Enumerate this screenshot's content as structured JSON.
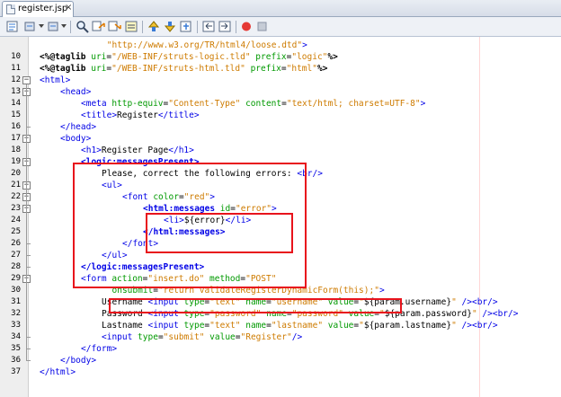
{
  "tab": {
    "label": "register.jsp",
    "close": "×"
  },
  "toolbar": {
    "icons": [
      "last-edit-icon",
      "back-icon",
      "forward-icon",
      "find-icon",
      "find-previous-icon",
      "find-next-icon",
      "toggle-highlight-icon",
      "previous-bookmark-icon",
      "next-bookmark-icon",
      "toggle-bookmark-icon",
      "shift-left-icon",
      "shift-right-icon",
      "start-macro-icon",
      "stop-macro-icon"
    ]
  },
  "editor": {
    "lines": [
      {
        "num": "",
        "segs": [
          {
            "c": "str",
            "t": "\"http://www.w3.org/TR/html4/loose.dtd\""
          },
          {
            "c": "tag",
            "t": ">"
          }
        ],
        "indent": 13
      },
      {
        "num": "10",
        "segs": [
          {
            "c": "jsp",
            "t": "<%@"
          },
          {
            "c": "jsp",
            "t": "taglib "
          },
          {
            "c": "attr",
            "t": "uri"
          },
          {
            "c": "txt",
            "t": "="
          },
          {
            "c": "str",
            "t": "\"/WEB-INF/struts-logic.tld\""
          },
          {
            "c": "txt",
            "t": " "
          },
          {
            "c": "attr",
            "t": "prefix"
          },
          {
            "c": "txt",
            "t": "="
          },
          {
            "c": "str",
            "t": "\"logic\""
          },
          {
            "c": "jsp",
            "t": "%>"
          }
        ],
        "indent": 0
      },
      {
        "num": "11",
        "segs": [
          {
            "c": "jsp",
            "t": "<%@"
          },
          {
            "c": "jsp",
            "t": "taglib "
          },
          {
            "c": "attr",
            "t": "uri"
          },
          {
            "c": "txt",
            "t": "="
          },
          {
            "c": "str",
            "t": "\"/WEB-INF/struts-html.tld\""
          },
          {
            "c": "txt",
            "t": " "
          },
          {
            "c": "attr",
            "t": "prefix"
          },
          {
            "c": "txt",
            "t": "="
          },
          {
            "c": "str",
            "t": "\"html\""
          },
          {
            "c": "jsp",
            "t": "%>"
          }
        ],
        "indent": 0
      },
      {
        "num": "12",
        "segs": [
          {
            "c": "tag",
            "t": "<html>"
          }
        ],
        "indent": 0
      },
      {
        "num": "13",
        "segs": [
          {
            "c": "tag",
            "t": "<head>"
          }
        ],
        "indent": 4
      },
      {
        "num": "14",
        "segs": [
          {
            "c": "tag",
            "t": "<meta "
          },
          {
            "c": "attr",
            "t": "http-equiv"
          },
          {
            "c": "txt",
            "t": "="
          },
          {
            "c": "str",
            "t": "\"Content-Type\""
          },
          {
            "c": "txt",
            "t": " "
          },
          {
            "c": "attr",
            "t": "content"
          },
          {
            "c": "txt",
            "t": "="
          },
          {
            "c": "str",
            "t": "\"text/html; charset=UTF-8\""
          },
          {
            "c": "tag",
            "t": ">"
          }
        ],
        "indent": 8
      },
      {
        "num": "15",
        "segs": [
          {
            "c": "tag",
            "t": "<title>"
          },
          {
            "c": "txt",
            "t": "Register"
          },
          {
            "c": "tag",
            "t": "</title>"
          }
        ],
        "indent": 8
      },
      {
        "num": "16",
        "segs": [
          {
            "c": "tag",
            "t": "</head>"
          }
        ],
        "indent": 4
      },
      {
        "num": "17",
        "segs": [
          {
            "c": "tag",
            "t": "<body>"
          }
        ],
        "indent": 4
      },
      {
        "num": "18",
        "segs": [
          {
            "c": "tag",
            "t": "<h1>"
          },
          {
            "c": "txt",
            "t": "Register Page"
          },
          {
            "c": "tag",
            "t": "</h1>"
          }
        ],
        "indent": 8
      },
      {
        "num": "19",
        "segs": [
          {
            "c": "tagb",
            "t": "<logic:messagesPresent>"
          }
        ],
        "indent": 8
      },
      {
        "num": "20",
        "segs": [
          {
            "c": "txt",
            "t": "Please, correct the following errors: "
          },
          {
            "c": "tag",
            "t": "<br/>"
          }
        ],
        "indent": 12
      },
      {
        "num": "21",
        "segs": [
          {
            "c": "tag",
            "t": "<ul>"
          }
        ],
        "indent": 12
      },
      {
        "num": "22",
        "segs": [
          {
            "c": "tag",
            "t": "<font "
          },
          {
            "c": "attr",
            "t": "color"
          },
          {
            "c": "txt",
            "t": "="
          },
          {
            "c": "str",
            "t": "\"red\""
          },
          {
            "c": "tag",
            "t": ">"
          }
        ],
        "indent": 16
      },
      {
        "num": "23",
        "segs": [
          {
            "c": "tagb",
            "t": "<html:messages "
          },
          {
            "c": "attr",
            "t": "id"
          },
          {
            "c": "txt",
            "t": "="
          },
          {
            "c": "str",
            "t": "\"error\""
          },
          {
            "c": "tag",
            "t": ">"
          }
        ],
        "indent": 20
      },
      {
        "num": "24",
        "segs": [
          {
            "c": "tag",
            "t": "<li>"
          },
          {
            "c": "txt",
            "t": "${error}"
          },
          {
            "c": "tag",
            "t": "</li>"
          }
        ],
        "indent": 24
      },
      {
        "num": "25",
        "segs": [
          {
            "c": "tagb",
            "t": "</html:messages>"
          }
        ],
        "indent": 20
      },
      {
        "num": "26",
        "segs": [
          {
            "c": "tag",
            "t": "</font>"
          }
        ],
        "indent": 16
      },
      {
        "num": "27",
        "segs": [
          {
            "c": "tag",
            "t": "</ul>"
          }
        ],
        "indent": 12
      },
      {
        "num": "28",
        "segs": [
          {
            "c": "tagb",
            "t": "</logic:messagesPresent>"
          }
        ],
        "indent": 8
      },
      {
        "num": "29",
        "segs": [
          {
            "c": "tag",
            "t": "<form "
          },
          {
            "c": "attr",
            "t": "action"
          },
          {
            "c": "txt",
            "t": "="
          },
          {
            "c": "str",
            "t": "\"insert.do\""
          },
          {
            "c": "txt",
            "t": " "
          },
          {
            "c": "attr",
            "t": "method"
          },
          {
            "c": "txt",
            "t": "="
          },
          {
            "c": "str",
            "t": "\"POST\""
          }
        ],
        "indent": 8
      },
      {
        "num": "30",
        "segs": [
          {
            "c": "attr",
            "t": "onsubmit"
          },
          {
            "c": "txt",
            "t": "="
          },
          {
            "c": "str",
            "t": "\"return validateRegisterDynamicForm(this);\""
          },
          {
            "c": "tag",
            "t": ">"
          }
        ],
        "indent": 14
      },
      {
        "num": "31",
        "segs": [
          {
            "c": "txt",
            "t": "Username "
          },
          {
            "c": "tag",
            "t": "<input "
          },
          {
            "c": "attr",
            "t": "type"
          },
          {
            "c": "txt",
            "t": "="
          },
          {
            "c": "str",
            "t": "\"text\""
          },
          {
            "c": "txt",
            "t": " "
          },
          {
            "c": "attr",
            "t": "name"
          },
          {
            "c": "txt",
            "t": "="
          },
          {
            "c": "str",
            "t": "\"username\""
          },
          {
            "c": "txt",
            "t": " "
          },
          {
            "c": "attr",
            "t": "value"
          },
          {
            "c": "txt",
            "t": "="
          },
          {
            "c": "str",
            "t": "\""
          },
          {
            "c": "txt",
            "t": "${param.username}"
          },
          {
            "c": "str",
            "t": "\""
          },
          {
            "c": "tag",
            "t": " /><br/>"
          }
        ],
        "indent": 12
      },
      {
        "num": "32",
        "segs": [
          {
            "c": "txt",
            "t": "Password "
          },
          {
            "c": "tag",
            "t": "<input "
          },
          {
            "c": "attr",
            "t": "type"
          },
          {
            "c": "txt",
            "t": "="
          },
          {
            "c": "str",
            "t": "\"password\""
          },
          {
            "c": "txt",
            "t": " "
          },
          {
            "c": "attr",
            "t": "name"
          },
          {
            "c": "txt",
            "t": "="
          },
          {
            "c": "str",
            "t": "\"password\""
          },
          {
            "c": "txt",
            "t": " "
          },
          {
            "c": "attr",
            "t": "value"
          },
          {
            "c": "txt",
            "t": "="
          },
          {
            "c": "str",
            "t": "\""
          },
          {
            "c": "txt",
            "t": "${param.password}"
          },
          {
            "c": "str",
            "t": "\""
          },
          {
            "c": "tag",
            "t": " /><br/>"
          }
        ],
        "indent": 12
      },
      {
        "num": "33",
        "segs": [
          {
            "c": "txt",
            "t": "Lastname "
          },
          {
            "c": "tag",
            "t": "<input "
          },
          {
            "c": "attr",
            "t": "type"
          },
          {
            "c": "txt",
            "t": "="
          },
          {
            "c": "str",
            "t": "\"text\""
          },
          {
            "c": "txt",
            "t": " "
          },
          {
            "c": "attr",
            "t": "name"
          },
          {
            "c": "txt",
            "t": "="
          },
          {
            "c": "str",
            "t": "\"lastname\""
          },
          {
            "c": "txt",
            "t": " "
          },
          {
            "c": "attr",
            "t": "value"
          },
          {
            "c": "txt",
            "t": "="
          },
          {
            "c": "str",
            "t": "\""
          },
          {
            "c": "txt",
            "t": "${param.lastname}"
          },
          {
            "c": "str",
            "t": "\""
          },
          {
            "c": "tag",
            "t": " /><br/>"
          }
        ],
        "indent": 12
      },
      {
        "num": "34",
        "segs": [
          {
            "c": "tag",
            "t": "<input "
          },
          {
            "c": "attr",
            "t": "type"
          },
          {
            "c": "txt",
            "t": "="
          },
          {
            "c": "str",
            "t": "\"submit\""
          },
          {
            "c": "txt",
            "t": " "
          },
          {
            "c": "attr",
            "t": "value"
          },
          {
            "c": "txt",
            "t": "="
          },
          {
            "c": "str",
            "t": "\"Register\""
          },
          {
            "c": "tag",
            "t": "/>"
          }
        ],
        "indent": 12
      },
      {
        "num": "35",
        "segs": [
          {
            "c": "tag",
            "t": "</form>"
          }
        ],
        "indent": 8
      },
      {
        "num": "36",
        "segs": [
          {
            "c": "tag",
            "t": "</body>"
          }
        ],
        "indent": 4
      },
      {
        "num": "37",
        "segs": [
          {
            "c": "tag",
            "t": "</html>"
          }
        ],
        "indent": 0
      }
    ]
  },
  "colors": {
    "tag": "#0000e6",
    "attr": "#009900",
    "string": "#ce7b00",
    "text": "#000000",
    "highlight_box": "#e8131c"
  }
}
